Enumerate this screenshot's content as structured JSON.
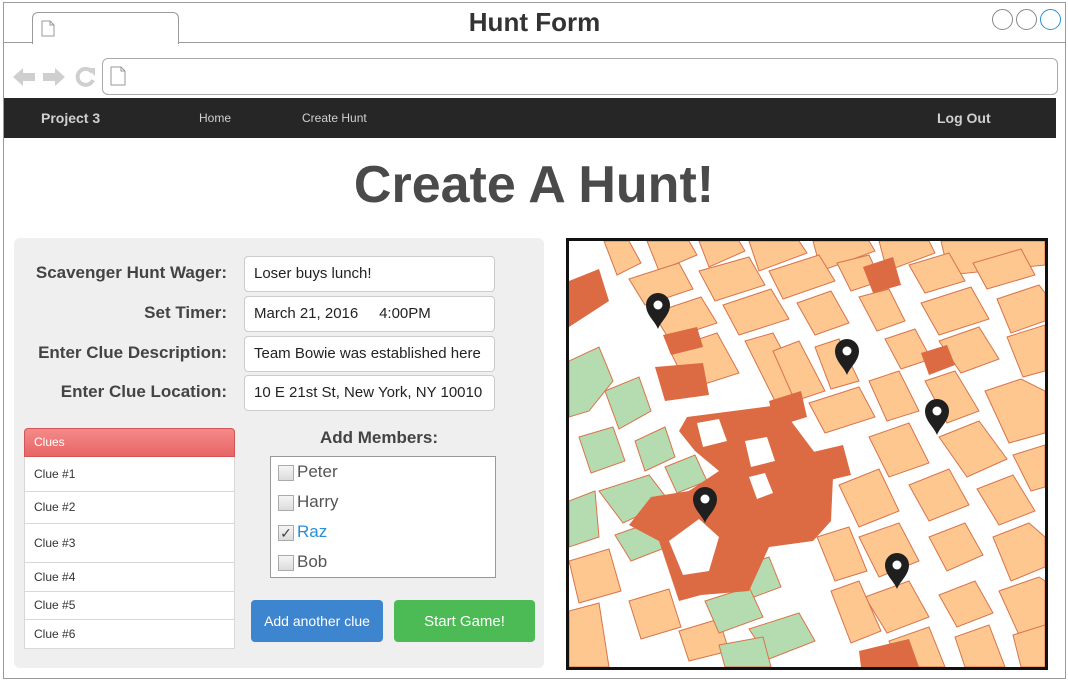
{
  "window": {
    "title": "Hunt Form"
  },
  "navbar": {
    "brand": "Project 3",
    "links": [
      "Home",
      "Create Hunt"
    ],
    "logout": "Log Out"
  },
  "page": {
    "heading": "Create A Hunt!"
  },
  "form": {
    "wager_label": "Scavenger Hunt Wager:",
    "wager_value": "Loser buys lunch!",
    "timer_label": "Set Timer:",
    "timer_value": "March 21, 2016     4:00PM",
    "clue_desc_label": "Enter Clue Description:",
    "clue_desc_value": "Team Bowie was established here",
    "clue_loc_label": "Enter Clue Location:",
    "clue_loc_value": "10 E 21st St, New York, NY 10010"
  },
  "clues": {
    "header": "Clues",
    "items": [
      "Clue #1",
      "Clue #2",
      "Clue #3",
      "Clue #4",
      "Clue #5",
      "Clue #6"
    ]
  },
  "members": {
    "title": "Add Members:",
    "items": [
      {
        "name": "Peter",
        "checked": false
      },
      {
        "name": "Harry",
        "checked": false
      },
      {
        "name": "Raz",
        "checked": true
      },
      {
        "name": "Bob",
        "checked": false
      }
    ]
  },
  "buttons": {
    "add_clue": "Add another clue",
    "start": "Start Game!"
  },
  "map": {
    "pin_icon": "map-pin-icon",
    "pin_count": 5
  },
  "colors": {
    "navbar": "#262626",
    "add_button": "#3d86cf",
    "start_button": "#4cbb55",
    "clues_header": "#ee7676",
    "map_block": "#fdc78f",
    "map_park": "#b5dcb0",
    "map_landmark": "#de6f44"
  }
}
